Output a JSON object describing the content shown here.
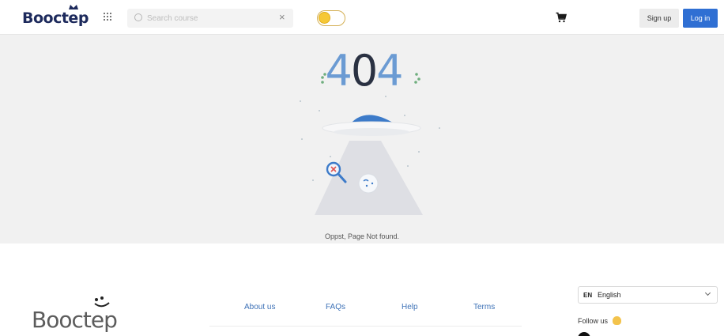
{
  "header": {
    "logo_text": "Booctep",
    "search_placeholder": "Search course",
    "signup_label": "Sign up",
    "login_label": "Log in",
    "icons": [
      "apps-grid-icon",
      "search-icon",
      "clear-icon",
      "theme-toggle",
      "cart-icon"
    ]
  },
  "error": {
    "code": "404",
    "message": "Oppst, Page Not found."
  },
  "footer": {
    "logo_text": "Booctep",
    "links": [
      "About us",
      "FAQs",
      "Help",
      "Terms"
    ],
    "language": {
      "flag": "EN",
      "label": "English"
    },
    "follow_label": "Follow us"
  },
  "colors": {
    "brand_navy": "#1d2a5c",
    "primary_blue": "#2f6fd3",
    "link_blue": "#3e72b7",
    "toggle_yellow": "#f6c836",
    "ufo_blue": "#3d7bc9",
    "digit_blue": "#6b9bd3",
    "digit_dark": "#2a3142"
  }
}
